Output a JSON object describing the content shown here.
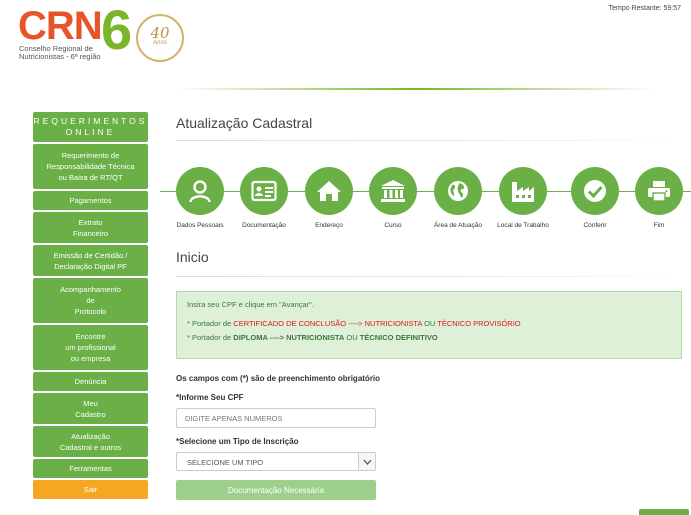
{
  "header": {
    "timer": "Tempo Restante: 59:57",
    "logo": {
      "crn": "CRN",
      "number": "6",
      "subtitle_line1": "Conselho Regional de",
      "subtitle_line2": "Nutricionistas - 6ª região",
      "seal_number": "40",
      "seal_text": "Anos"
    }
  },
  "sidebar": {
    "heading_line1": "REQUERIMENTOS",
    "heading_line2": "ONLINE",
    "items": [
      {
        "label": "Requerimento de\nResponsabilidade Técnica\nou Baixa de RT/QT",
        "color": "#6ab047"
      },
      {
        "label": "Pagamentos",
        "color": "#6ab047"
      },
      {
        "label": "Extrato\nFinanceiro",
        "color": "#6ab047"
      },
      {
        "label": "Emissão de Certidão /\nDeclaração Digital PF",
        "color": "#6ab047"
      },
      {
        "label": "Acompanhamento\nde\nProtocolo",
        "color": "#6ab047"
      },
      {
        "label": "Encontre\num profissional\nou empresa",
        "color": "#6ab047"
      },
      {
        "label": "Denúncia",
        "color": "#6ab047"
      },
      {
        "label": "Meu\nCadastro",
        "color": "#6ab047"
      },
      {
        "label": "Atualização\nCadastral e outros",
        "color": "#6ab047"
      },
      {
        "label": "Ferramentas",
        "color": "#6ab047"
      },
      {
        "label": "Sair",
        "color": "#f5a623"
      }
    ]
  },
  "main": {
    "title": "Atualização Cadastral",
    "steps": [
      {
        "label": "Dados Pessoais",
        "icon": "user-icon"
      },
      {
        "label": "Documentação",
        "icon": "id-card-icon"
      },
      {
        "label": "Endereço",
        "icon": "home-icon"
      },
      {
        "label": "Curso",
        "icon": "institution-icon"
      },
      {
        "label": "Área de Atuação",
        "icon": "globe-icon"
      },
      {
        "label": "Local de Trabalho",
        "icon": "factory-icon"
      },
      {
        "label": "Conferir",
        "icon": "check-icon"
      },
      {
        "label": "Fim",
        "icon": "printer-icon"
      }
    ],
    "section_title": "Inicio",
    "info": {
      "intro": "Insira seu CPF e clique em \"Avançar\".",
      "line1_prefix": "* Portador de ",
      "line1_cert": "CERTIFICADO DE CONCLUSÃO ----> NUTRICIONISTA",
      "line1_or": " OU ",
      "line1_tech": "TÉCNICO PROVISÓRIO",
      "line2_prefix": "* Portador de ",
      "line2_dip": "DIPLOMA ----> NUTRICIONISTA",
      "line2_or": " OU ",
      "line2_tech": "TÉCNICO DEFINITIVO"
    },
    "required_note": "Os campos com (*) são de preenchimento obrigatório",
    "cpf_label": "*Informe Seu CPF",
    "cpf_placeholder": "DIGITE APENAS NUMEROS",
    "tipo_label": "*Selecione um Tipo de Inscrição",
    "tipo_selected": "SELECIONE UM TIPO",
    "doc_button": "Documentação Necessária"
  },
  "colors": {
    "brand_green": "#6ab047",
    "brand_orange": "#e8542a",
    "sair": "#f5a623"
  }
}
